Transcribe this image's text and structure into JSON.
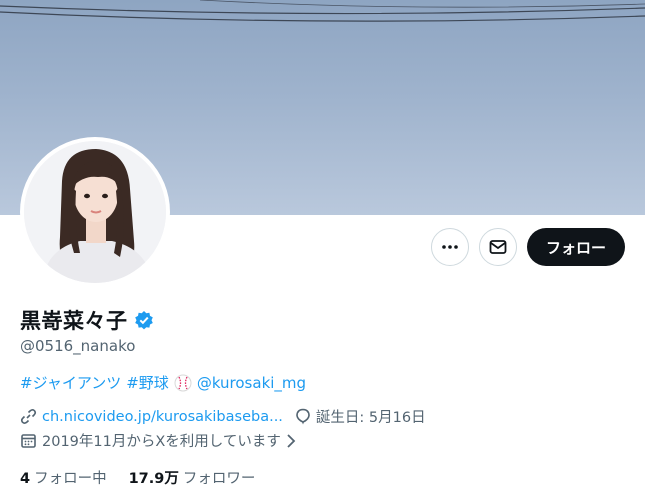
{
  "profile": {
    "display_name": "黒嵜菜々子",
    "handle": "@0516_nanako",
    "verified": true,
    "bio": {
      "tag1": "#ジャイアンツ",
      "tag2": "#野球",
      "emoji_icon": "baseball-icon",
      "mention": "@kurosaki_mg"
    },
    "link": "ch.nicovideo.jp/kurosakibaseba...",
    "birthday": "誕生日: 5月16日",
    "joined": "2019年11月からXを利用しています",
    "following_count": "4",
    "following_label": "フォロー中",
    "followers_count": "17.9万",
    "followers_label": "フォロワー"
  },
  "actions": {
    "more_icon": "more-icon",
    "message_icon": "message-icon",
    "follow_label": "フォロー"
  },
  "colors": {
    "accent": "#1d9bf0",
    "follow_button": "#0f1419",
    "secondary_text": "#536471"
  }
}
